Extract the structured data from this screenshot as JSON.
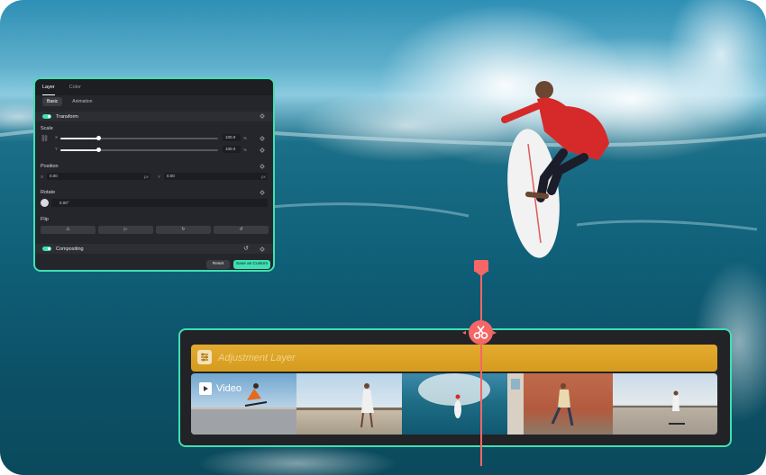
{
  "panel": {
    "tabs": [
      {
        "label": "Layer",
        "active": true
      },
      {
        "label": "Color",
        "active": false
      }
    ],
    "subtabs": [
      {
        "label": "Basic",
        "active": true
      },
      {
        "label": "Animation",
        "active": false
      }
    ],
    "transform": {
      "title": "Transform",
      "scale_label": "Scale",
      "scale_x": {
        "axis": "X",
        "value": "100.0",
        "unit": "%"
      },
      "scale_y": {
        "axis": "Y",
        "value": "100.0",
        "unit": "%"
      },
      "position_label": "Position",
      "position_x": {
        "axis": "X",
        "value": "0.00",
        "unit": "px"
      },
      "position_y": {
        "axis": "Y",
        "value": "0.00",
        "unit": "px"
      },
      "rotate_label": "Rotate",
      "rotate_value": "0.00°",
      "flip_label": "Flip"
    },
    "compositing": {
      "title": "Compositing"
    },
    "buttons": {
      "reset": "Reset",
      "save": "Save as Custom"
    }
  },
  "timeline": {
    "adjustment_label": "Adjustment Layer",
    "video_label": "Video",
    "frames": 5
  },
  "colors": {
    "accent": "#3fe0b4",
    "playhead": "#f56667",
    "adjustment": "#e2ab2f",
    "panel_bg": "#25262b"
  }
}
